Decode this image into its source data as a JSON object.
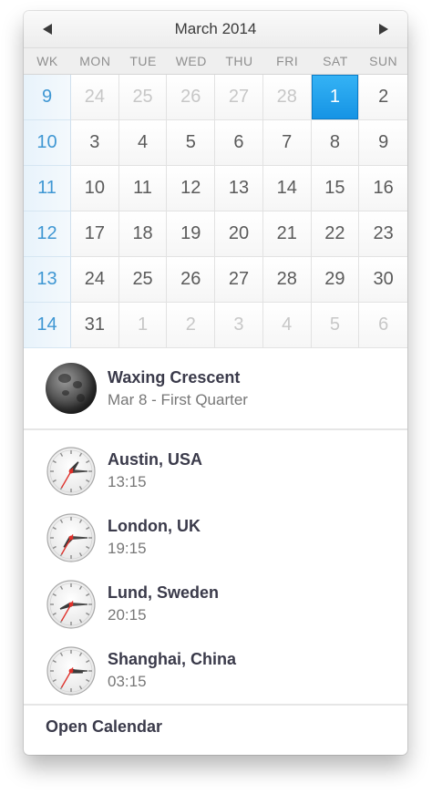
{
  "calendar": {
    "month_title": "March 2014",
    "weekday_headers": [
      "WK",
      "MON",
      "TUE",
      "WED",
      "THU",
      "FRI",
      "SAT",
      "SUN"
    ],
    "weeks": [
      {
        "wk": "9",
        "days": [
          {
            "d": "24",
            "dim": true
          },
          {
            "d": "25",
            "dim": true
          },
          {
            "d": "26",
            "dim": true
          },
          {
            "d": "27",
            "dim": true
          },
          {
            "d": "28",
            "dim": true
          },
          {
            "d": "1",
            "sel": true
          },
          {
            "d": "2"
          }
        ]
      },
      {
        "wk": "10",
        "days": [
          {
            "d": "3"
          },
          {
            "d": "4"
          },
          {
            "d": "5"
          },
          {
            "d": "6"
          },
          {
            "d": "7"
          },
          {
            "d": "8"
          },
          {
            "d": "9"
          }
        ]
      },
      {
        "wk": "11",
        "days": [
          {
            "d": "10"
          },
          {
            "d": "11"
          },
          {
            "d": "12"
          },
          {
            "d": "13"
          },
          {
            "d": "14"
          },
          {
            "d": "15"
          },
          {
            "d": "16"
          }
        ]
      },
      {
        "wk": "12",
        "days": [
          {
            "d": "17"
          },
          {
            "d": "18"
          },
          {
            "d": "19"
          },
          {
            "d": "20"
          },
          {
            "d": "21"
          },
          {
            "d": "22"
          },
          {
            "d": "23"
          }
        ]
      },
      {
        "wk": "13",
        "days": [
          {
            "d": "24"
          },
          {
            "d": "25"
          },
          {
            "d": "26"
          },
          {
            "d": "27"
          },
          {
            "d": "28"
          },
          {
            "d": "29"
          },
          {
            "d": "30"
          }
        ]
      },
      {
        "wk": "14",
        "days": [
          {
            "d": "31"
          },
          {
            "d": "1",
            "dim": true
          },
          {
            "d": "2",
            "dim": true
          },
          {
            "d": "3",
            "dim": true
          },
          {
            "d": "4",
            "dim": true
          },
          {
            "d": "5",
            "dim": true
          },
          {
            "d": "6",
            "dim": true
          }
        ]
      }
    ]
  },
  "moon": {
    "phase": "Waxing Crescent",
    "next": "Mar 8 - First Quarter",
    "icon": "moon-icon"
  },
  "clocks": [
    {
      "city": "Austin, USA",
      "time": "13:15"
    },
    {
      "city": "London, UK",
      "time": "19:15"
    },
    {
      "city": "Lund, Sweden",
      "time": "20:15"
    },
    {
      "city": "Shanghai, China",
      "time": "03:15"
    }
  ],
  "footer": {
    "open_calendar": "Open Calendar"
  },
  "colors": {
    "selected_day": "#1a9be8",
    "week_number": "#3f97d3",
    "second_hand": "#e0302a"
  }
}
